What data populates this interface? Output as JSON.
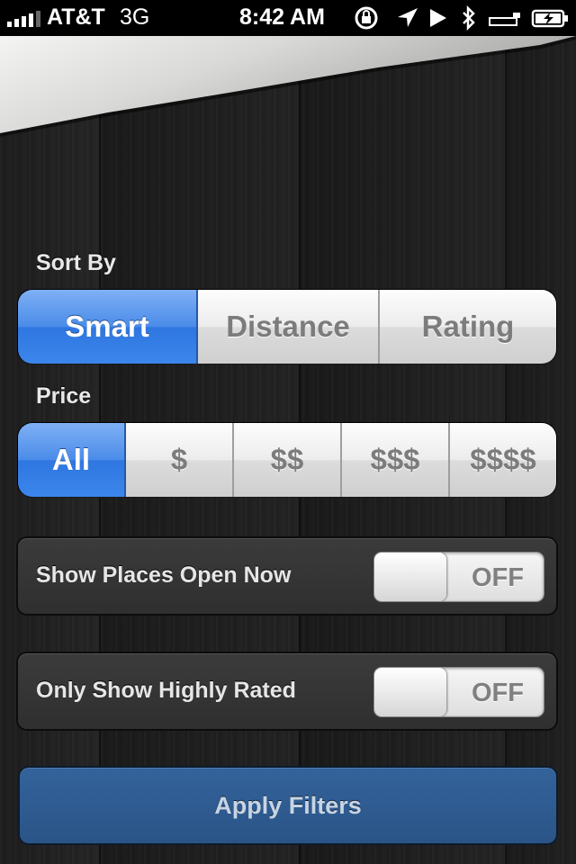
{
  "status_bar": {
    "carrier": "AT&T",
    "network": "3G",
    "time": "8:42 AM",
    "icons": [
      "signal-icon",
      "rotation-lock-icon",
      "location-icon",
      "play-icon",
      "bluetooth-icon",
      "charging-icon",
      "battery-icon"
    ]
  },
  "sort_by": {
    "label": "Sort By",
    "options": [
      "Smart",
      "Distance",
      "Rating"
    ],
    "selected": "Smart"
  },
  "price": {
    "label": "Price",
    "options": [
      "All",
      "$",
      "$$",
      "$$$",
      "$$$$"
    ],
    "selected": "All"
  },
  "toggles": [
    {
      "label": "Show Places Open Now",
      "state": "OFF"
    },
    {
      "label": "Only Show Highly Rated",
      "state": "OFF"
    }
  ],
  "apply_button": {
    "label": "Apply Filters"
  },
  "colors": {
    "accent_blue": "#3b86ec",
    "apply_button": "#2f5d93",
    "background": "#1f1f20"
  }
}
